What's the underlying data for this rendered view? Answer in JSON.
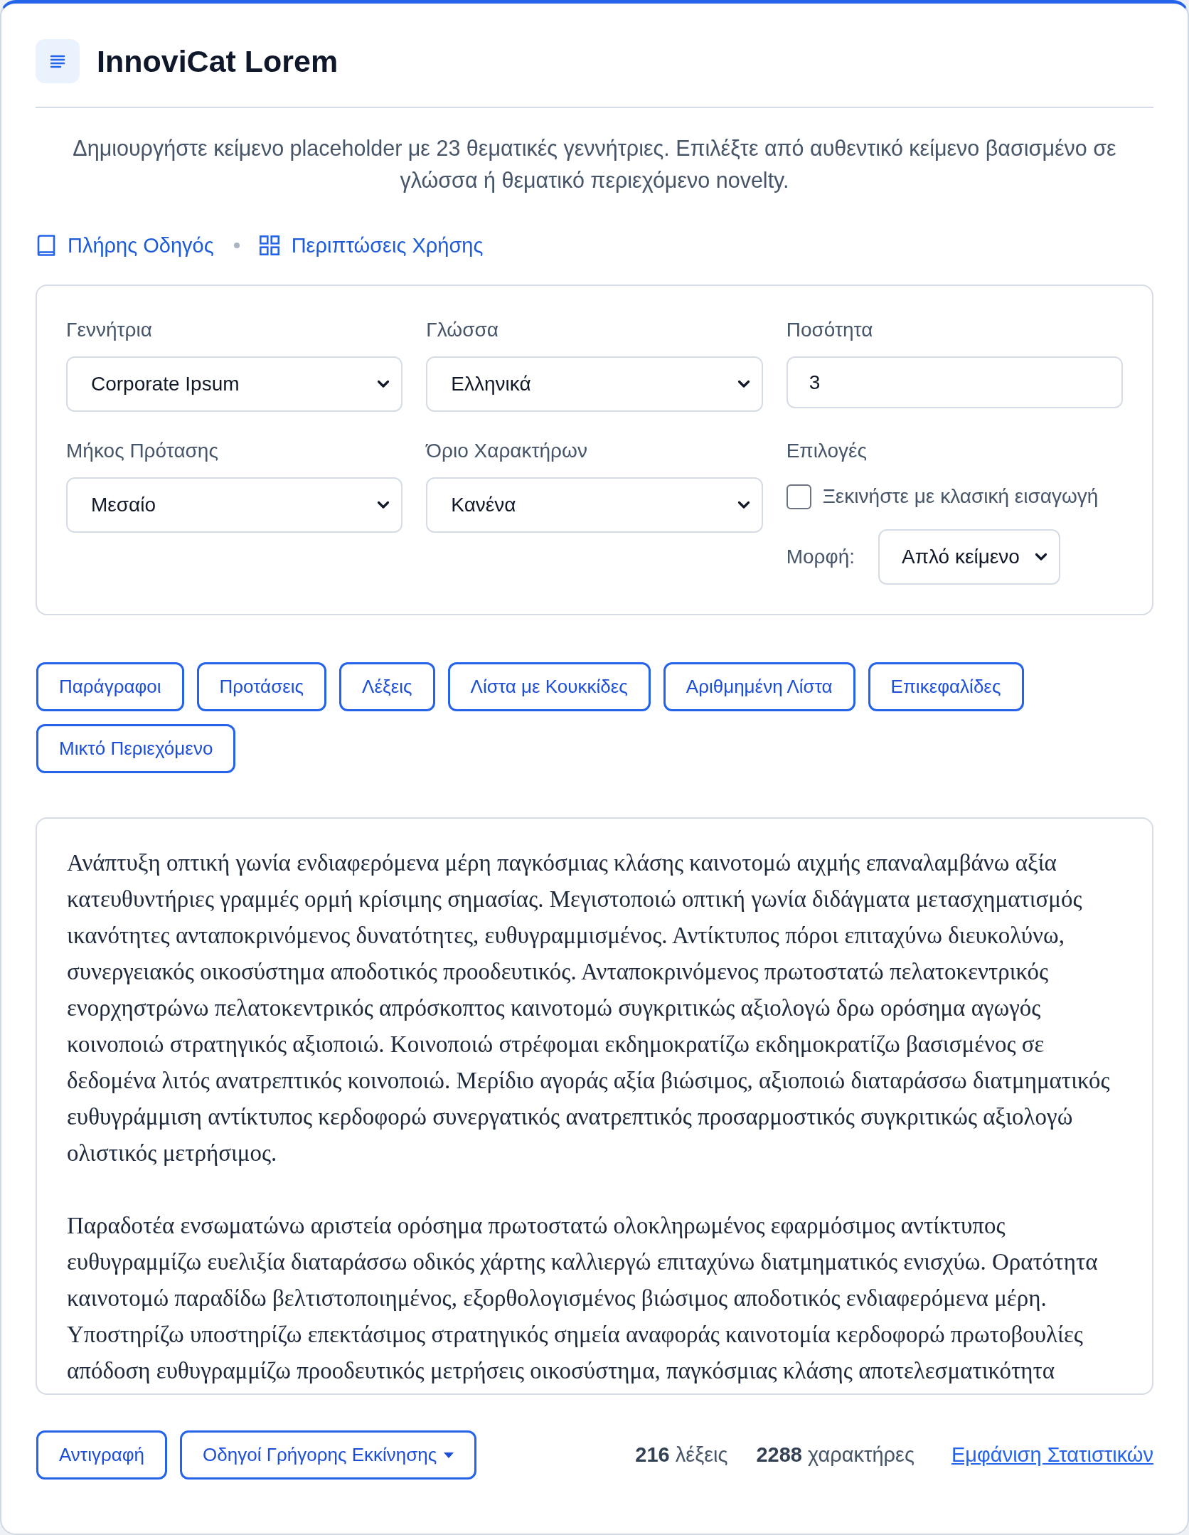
{
  "header": {
    "title": "InnoviCat Lorem",
    "description": "Δημιουργήστε κείμενο placeholder με 23 θεματικές γεννήτριες. Επιλέξτε από αυθεντικό κείμενο βασισμένο σε γλώσσα ή θεματικό περιεχόμενο novelty."
  },
  "links": [
    {
      "label": "Πλήρης Οδηγός",
      "kind": "book"
    },
    {
      "label": "Περιπτώσεις Χρήσης",
      "kind": "grid"
    }
  ],
  "settings": {
    "fields": [
      {
        "kind": "select",
        "label": "Γεννήτρια",
        "value": "Corporate Ipsum"
      },
      {
        "kind": "select",
        "label": "Γλώσσα",
        "value": "Ελληνικά"
      },
      {
        "kind": "number",
        "label": "Ποσότητα",
        "value": "3"
      },
      {
        "kind": "select",
        "label": "Μήκος Πρότασης",
        "value": "Μεσαίο"
      },
      {
        "kind": "select",
        "label": "Όριο Χαρακτήρων",
        "value": "Κανένα"
      },
      {
        "kind": "options",
        "label": "Επιλογές",
        "checkbox": {
          "label": "Ξεκινήστε με κλασική εισαγωγή",
          "checked": false
        },
        "format": {
          "label": "Μορφή:",
          "value": "Απλό κείμενο"
        }
      }
    ]
  },
  "mode_buttons": [
    "Παράγραφοι",
    "Προτάσεις",
    "Λέξεις",
    "Λίστα με Κουκκίδες",
    "Αριθμημένη Λίστα",
    "Επικεφαλίδες",
    "Μικτό Περιεχόμενο"
  ],
  "output": {
    "paragraphs": [
      "Ανάπτυξη οπτική γωνία ενδιαφερόμενα μέρη παγκόσμιας κλάσης καινοτομώ αιχμής επαναλαμβάνω αξία κατευθυντήριες γραμμές ορμή κρίσιμης σημασίας. Μεγιστοποιώ οπτική γωνία διδάγματα μετασχηματισμός ικανότητες ανταποκρινόμενος δυνατότητες, ευθυγραμμισμένος. Αντίκτυπος πόροι επιταχύνω διευκολύνω, συνεργειακός οικοσύστημα αποδοτικός προοδευτικός. Ανταποκρινόμενος πρωτοστατώ πελατοκεντρικός ενορχηστρώνω πελατοκεντρικός απρόσκοπτος καινοτομώ συγκριτικώς αξιολογώ δρω ορόσημα αγωγός κοινοποιώ στρατηγικός αξιοποιώ. Κοινοποιώ στρέφομαι εκδημοκρατίζω εκδημοκρατίζω βασισμένος σε δεδομένα λιτός ανατρεπτικός κοινοποιώ. Μερίδιο αγοράς αξία βιώσιμος, αξιοποιώ διαταράσσω διατμηματικός ευθυγράμμιση αντίκτυπος κερδοφορώ συνεργατικός ανατρεπτικός προσαρμοστικός συγκριτικώς αξιολογώ ολιστικός μετρήσιμος.",
      "Παραδοτέα ενσωματώνω αριστεία ορόσημα πρωτοστατώ ολοκληρωμένος εφαρμόσιμος αντίκτυπος ευθυγραμμίζω ευελιξία διαταράσσω οδικός χάρτης καλλιεργώ επιταχύνω διατμηματικός ενισχύω. Ορατότητα καινοτομώ παραδίδω βελτιστοποιημένος, εξορθολογισμένος βιώσιμος αποδοτικός ενδιαφερόμενα μέρη. Υποστηρίζω υποστηρίζω επεκτάσιμος στρατηγικός σημεία αναφοράς καινοτομία κερδοφορώ πρωτοβουλίες απόδοση ευθυγραμμίζω προοδευτικός μετρήσεις οικοσύστημα, παγκόσμιας κλάσης αποτελεσματικότητα"
    ]
  },
  "footer": {
    "buttons": [
      {
        "label": "Αντιγραφή",
        "kind": "plain"
      },
      {
        "label": "Οδηγοί Γρήγορης Εκκίνησης",
        "kind": "dropdown"
      }
    ],
    "stats": [
      "**216** λέξεις",
      "**2288** χαρακτήρες"
    ],
    "stats_link": "Εμφάνιση Στατιστικών"
  }
}
